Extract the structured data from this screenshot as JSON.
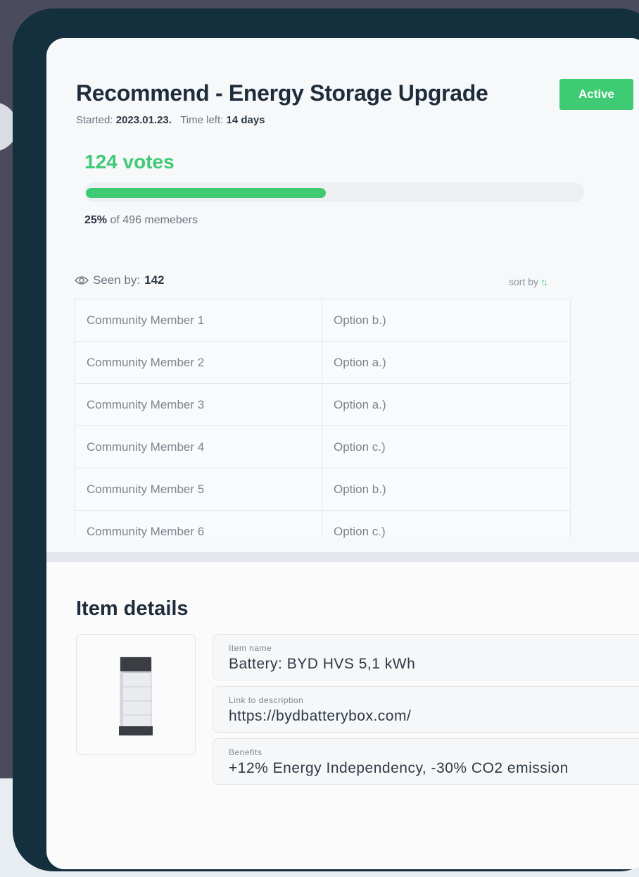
{
  "poll": {
    "title": "Recommend - Energy Storage Upgrade",
    "status": "Active",
    "started_label": "Started:",
    "started_value": "2023.01.23.",
    "time_left_label": "Time left:",
    "time_left_value": "14 days",
    "votes_text": "124 votes",
    "progress_fraction": 0.48,
    "percent_text": "25%",
    "members_text": "of 496 memebers"
  },
  "seen": {
    "label": "Seen by:",
    "count": "142",
    "sort_label": "sort by"
  },
  "table": {
    "rows": [
      {
        "member": "Community Member 1",
        "option": "Option b.)"
      },
      {
        "member": "Community Member 2",
        "option": "Option a.)"
      },
      {
        "member": "Community Member 3",
        "option": "Option a.)"
      },
      {
        "member": "Community Member 4",
        "option": "Option c.)"
      },
      {
        "member": "Community Member 5",
        "option": "Option b.)"
      },
      {
        "member": "Community Member 6",
        "option": "Option c.)"
      }
    ]
  },
  "details": {
    "title": "Item details",
    "fields": [
      {
        "label": "Item name",
        "value": "Battery: BYD HVS 5,1 kWh"
      },
      {
        "label": "Link to description",
        "value": "https://bydbatterybox.com/"
      },
      {
        "label": "Benefits",
        "value": "+12% Energy Independency, -30% CO2 emission"
      }
    ]
  },
  "colors": {
    "accent": "#3ecb74",
    "frame": "#14303e",
    "background": "#4b4b5e"
  },
  "icons": {
    "seen": "eye-icon",
    "sort": "sort-arrows-icon",
    "product": "battery-image"
  }
}
